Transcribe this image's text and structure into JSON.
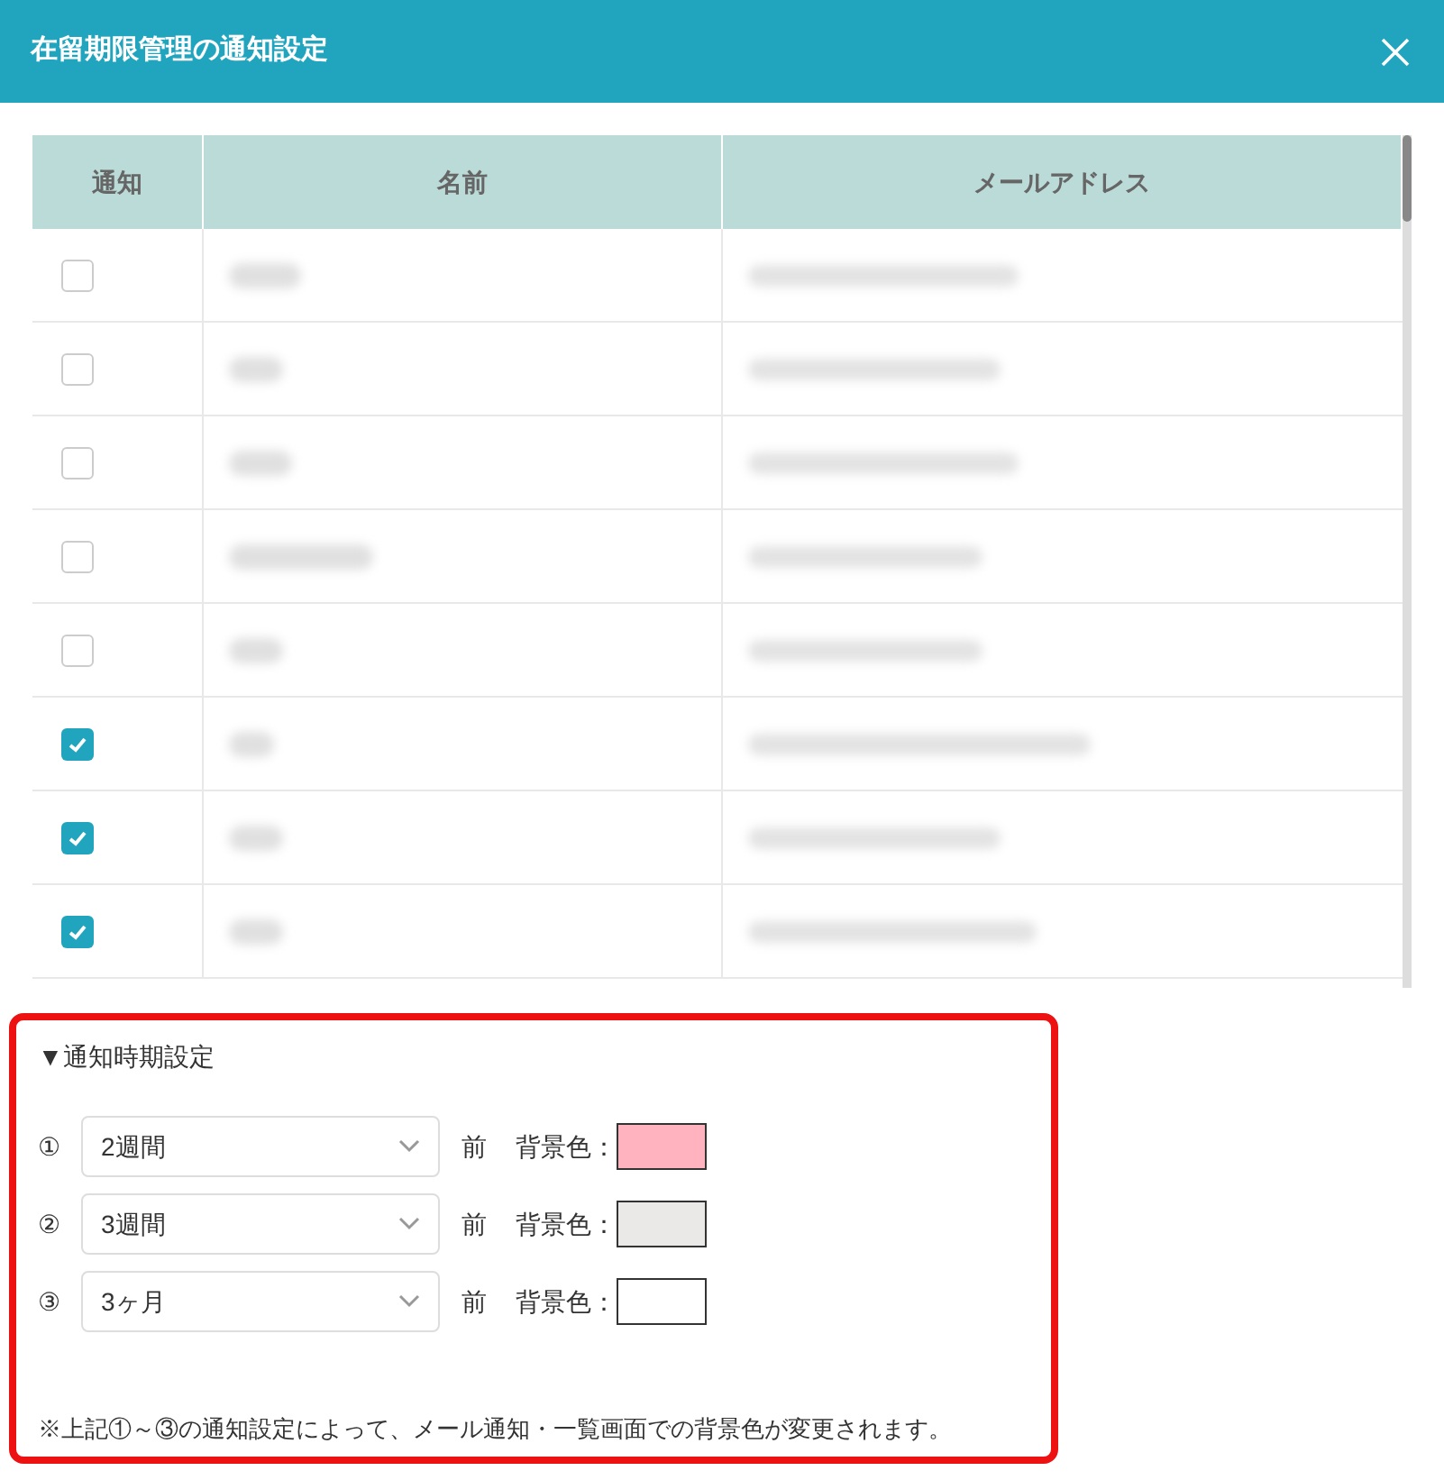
{
  "dialog": {
    "title": "在留期限管理の通知設定"
  },
  "table": {
    "columns": [
      "通知",
      "名前",
      "メールアドレス"
    ],
    "rows": [
      {
        "checked": false
      },
      {
        "checked": false
      },
      {
        "checked": false
      },
      {
        "checked": false
      },
      {
        "checked": false
      },
      {
        "checked": true
      },
      {
        "checked": true
      },
      {
        "checked": true
      }
    ]
  },
  "timing": {
    "heading": "▼通知時期設定",
    "items": [
      {
        "number": "①",
        "value": "2週間",
        "before": "前",
        "color_label": "背景色：",
        "color": "#ffb3bf"
      },
      {
        "number": "②",
        "value": "3週間",
        "before": "前",
        "color_label": "背景色：",
        "color": "#ebe9e7"
      },
      {
        "number": "③",
        "value": "3ヶ月",
        "before": "前",
        "color_label": "背景色：",
        "color": "#ffffff"
      }
    ],
    "note": "※上記①～③の通知設定によって、メール通知・一覧画面での背景色が変更されます。"
  }
}
